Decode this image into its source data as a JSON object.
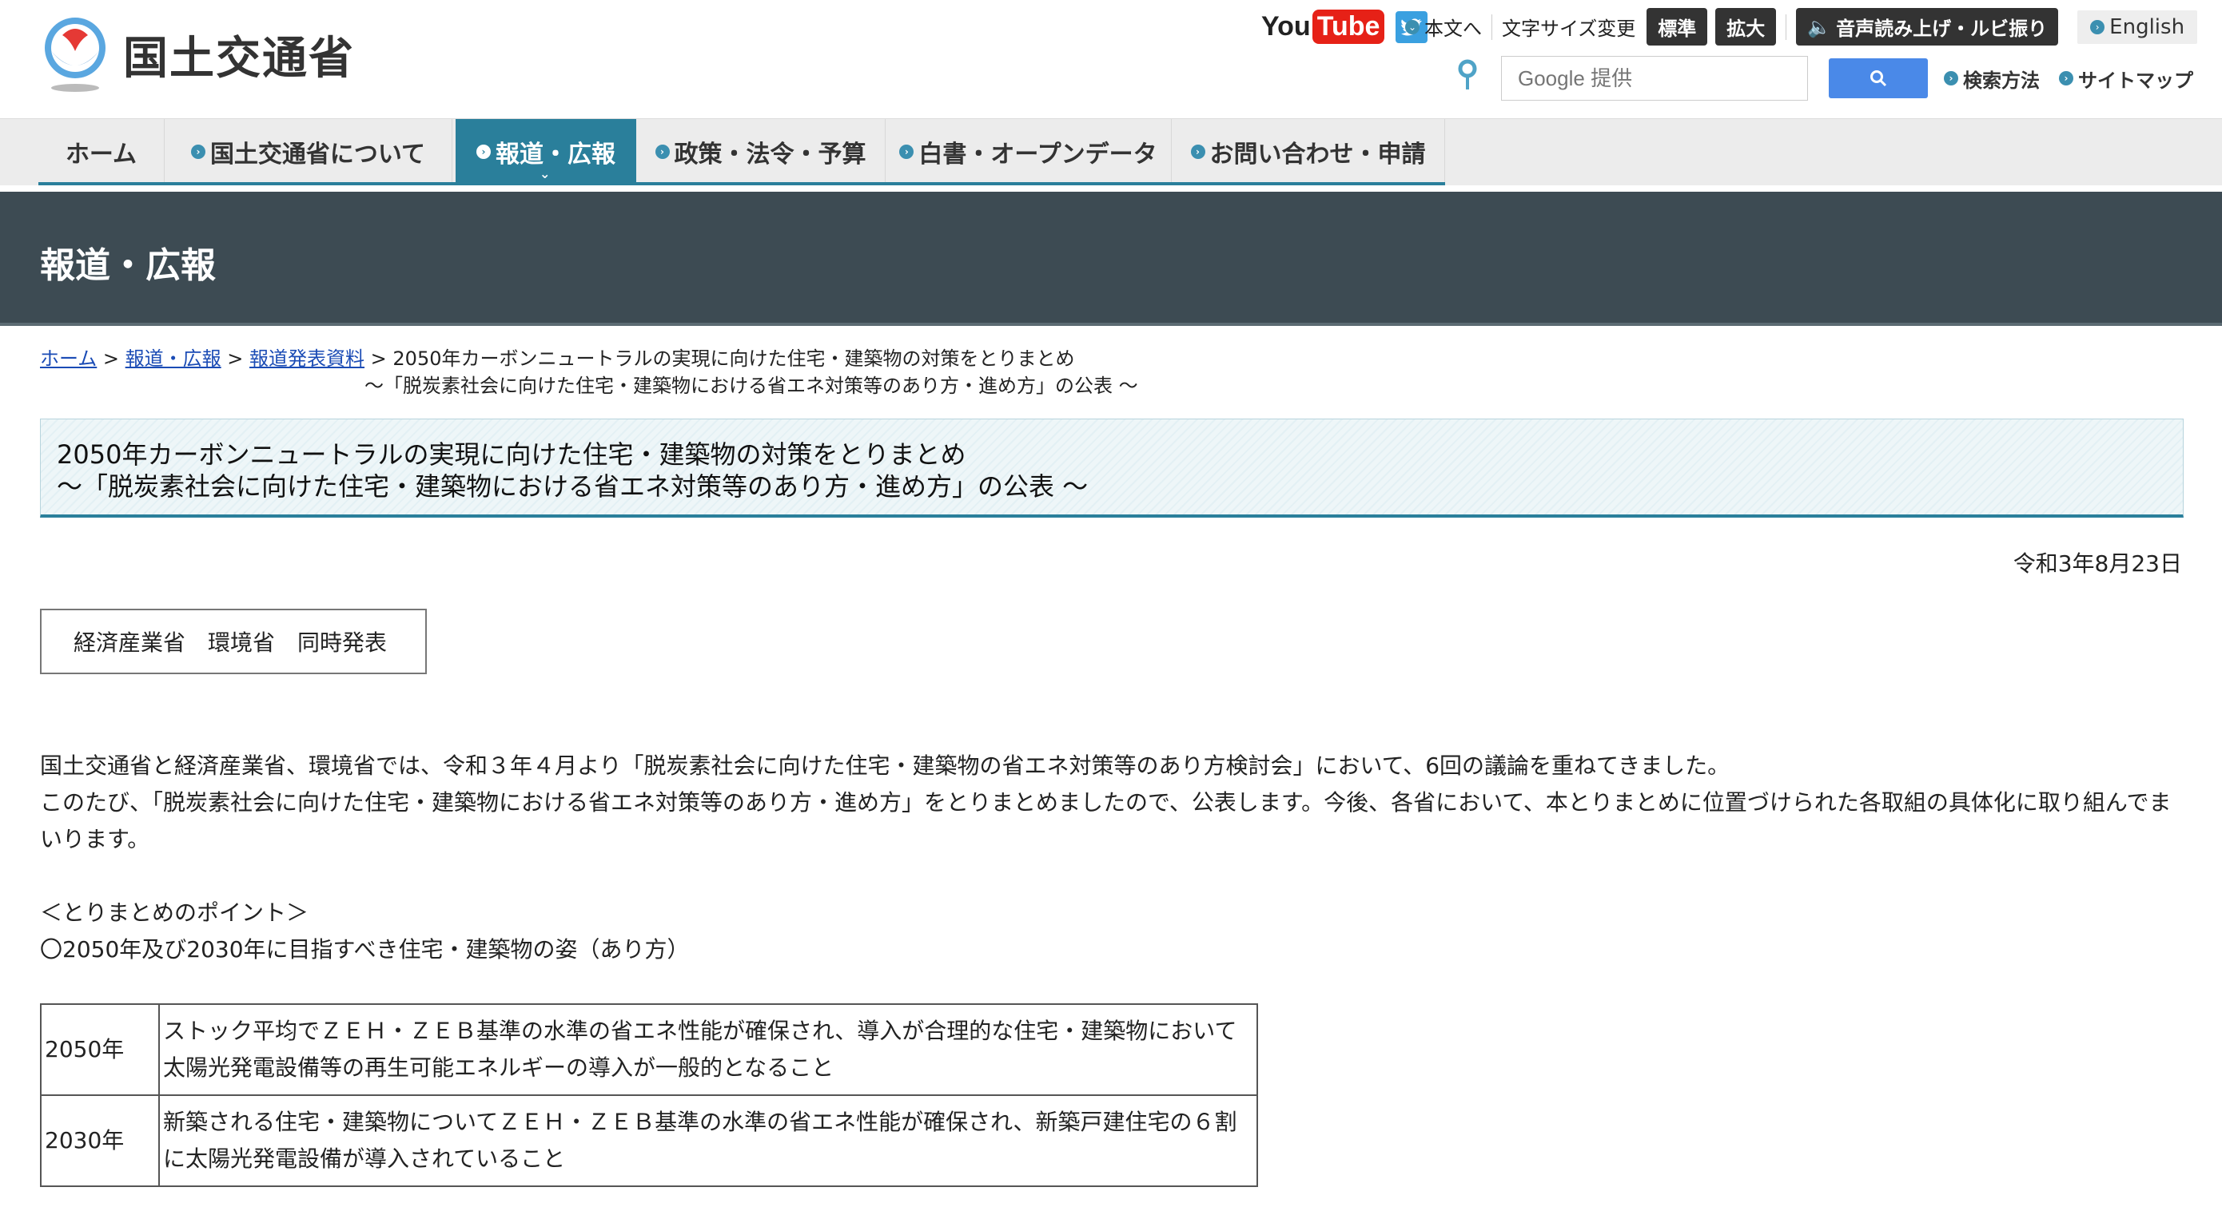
{
  "site": {
    "logo_text": "国土交通省"
  },
  "utility": {
    "youtube_you": "You",
    "youtube_tube": "Tube",
    "skip_to_body": "本文へ",
    "font_size_label": "文字サイズ変更",
    "font_standard": "標準",
    "font_large": "拡大",
    "read_aloud": "音声読み上げ・ルビ振り",
    "english": "English"
  },
  "search": {
    "placeholder": "Google 提供",
    "how_to_search": "検索方法",
    "sitemap": "サイトマップ"
  },
  "nav": {
    "items": [
      {
        "label": "ホーム"
      },
      {
        "label": "国土交通省について"
      },
      {
        "label": "報道・広報"
      },
      {
        "label": "政策・法令・予算"
      },
      {
        "label": "白書・オープンデータ"
      },
      {
        "label": "お問い合わせ・申請"
      }
    ],
    "active_index": 2
  },
  "page": {
    "section_title": "報道・広報"
  },
  "breadcrumb": {
    "home": "ホーム",
    "press": "報道・広報",
    "releases": "報道発表資料",
    "sep": " > ",
    "current_line1": "2050年カーボンニュートラルの実現に向けた住宅・建築物の対策をとりまとめ",
    "current_line2": "～「脱炭素社会に向けた住宅・建築物における省エネ対策等のあり方・進め方」の公表 ～"
  },
  "article": {
    "title_line1": "2050年カーボンニュートラルの実現に向けた住宅・建築物の対策をとりまとめ",
    "title_line2": "～「脱炭素社会に向けた住宅・建築物における省エネ対策等のあり方・進め方」の公表 ～",
    "date": "令和3年8月23日",
    "joint_release": "経済産業省　環境省　同時発表",
    "paragraph1": "国土交通省と経済産業省、環境省では、令和３年４月より「脱炭素社会に向けた住宅・建築物の省エネ対策等のあり方検討会」において、6回の議論を重ねてきました。",
    "paragraph2": "このたび、「脱炭素社会に向けた住宅・建築物における省エネ対策等のあり方・進め方」をとりまとめましたので、公表します。今後、各省において、本とりまとめに位置づけられた各取組の具体化に取り組んでまいります。",
    "points_heading": "＜とりまとめのポイント＞",
    "points_sub": "〇2050年及び2030年に目指すべき住宅・建築物の姿（あり方）",
    "table": [
      {
        "year": "2050年",
        "text": "ストック平均でＺＥＨ・ＺＥＢ基準の水準の省エネ性能が確保され、導入が合理的な住宅・建築物において太陽光発電設備等の再生可能エネルギーの導入が一般的となること"
      },
      {
        "year": "2030年",
        "text": "新築される住宅・建築物についてＺＥＨ・ＺＥＢ基準の水準の省エネ性能が確保され、新築戸建住宅の６割に太陽光発電設備が導入されていること"
      }
    ]
  },
  "colors": {
    "nav_active": "#2a7f9b",
    "band": "#3d4b53",
    "link": "#1a4bb5",
    "search_button": "#4a89e8",
    "youtube_red": "#e62117",
    "twitter_blue": "#3aa0e0"
  }
}
